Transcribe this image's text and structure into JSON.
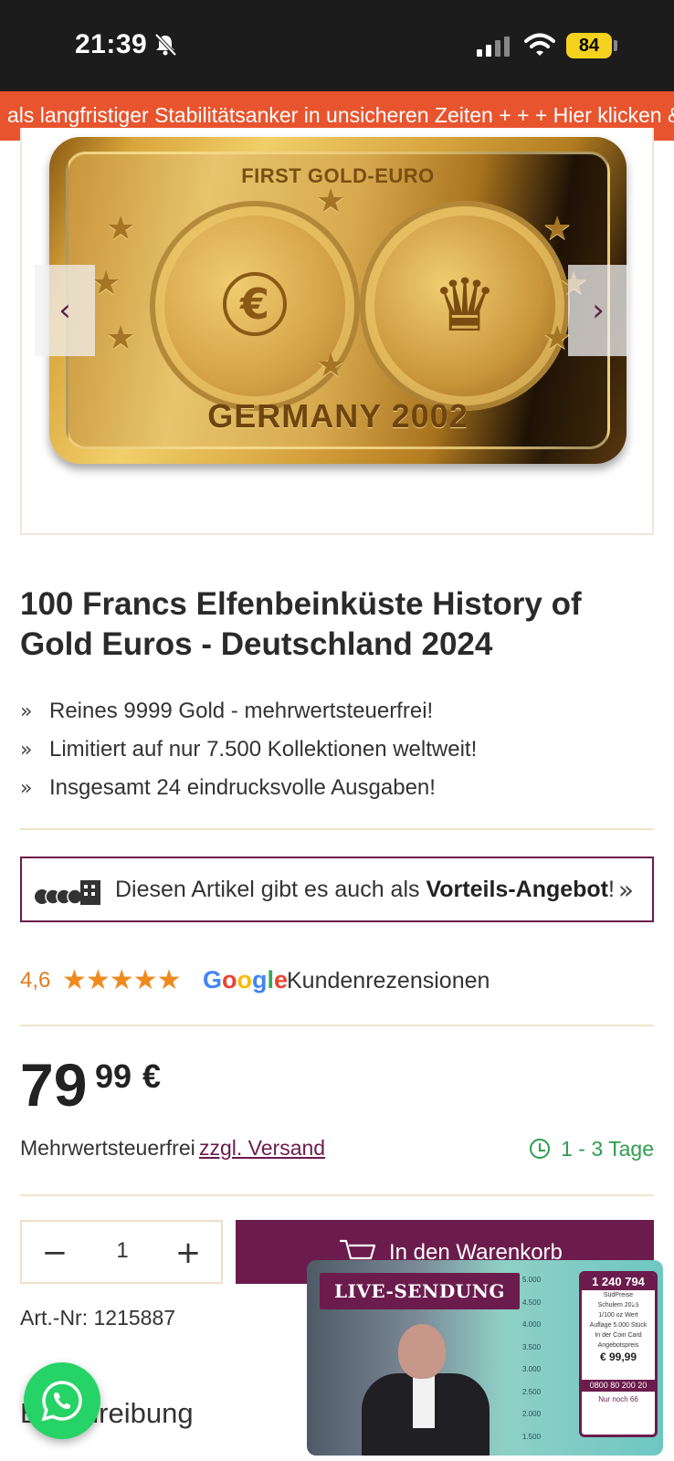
{
  "status_bar": {
    "time": "21:39",
    "battery": "84",
    "icons": [
      "bell-muted-icon",
      "signal-icon",
      "wifi-icon",
      "battery-icon"
    ]
  },
  "ticker": {
    "text": "als langfristiger Stabilitätsanker in unsicheren Zeiten + + + Hier klicken &",
    "color": "#e8542e"
  },
  "gallery": {
    "image_caption_top": "FIRST GOLD-EURO",
    "image_caption_bottom": "GERMANY 2002",
    "prev_label": "‹",
    "next_label": "›"
  },
  "product": {
    "title": "100 Francs Elfenbeinküste History of Gold Euros - Deutschland 2024",
    "bullets": [
      "Reines 9999 Gold - mehrwertsteuerfrei!",
      "Limitiert auf nur 7.500 Kollektionen weltweit!",
      "Insgesamt 24 eindrucksvolle Ausgaben!"
    ],
    "bullet_marker": "»"
  },
  "offer": {
    "text_prefix": "Diesen Artikel gibt es auch als ",
    "text_bold": "Vorteils-Angebot",
    "text_suffix": "!",
    "chevron": "»"
  },
  "rating": {
    "value": "4,6",
    "stars": "★★★★★",
    "stars_count": 5,
    "provider": "Google",
    "label": "Kundenrezensionen"
  },
  "price": {
    "whole": "79",
    "cents": "99",
    "currency": "€"
  },
  "shipping": {
    "vat": "Mehrwertsteuerfrei",
    "link": "zzgl. Versand",
    "delivery": "1 - 3 Tage"
  },
  "cart": {
    "quantity": "1",
    "minus": "−",
    "plus": "+",
    "button_label": "In den Warenkorb"
  },
  "article": {
    "number": "Art.-Nr: 1215887"
  },
  "description": {
    "heading": "Beschreibung"
  },
  "live": {
    "badge": "LIVE-SENDUNG",
    "card_number": "1 240 794",
    "card_lines": [
      "SüdPreise",
      "Schulem 2025",
      "1/100 oz Wert",
      "Auflage 5.000 Stück",
      "In der Coin Card",
      "Angebotspreis"
    ],
    "card_price": "€ 99,99",
    "card_phone": "0800 80 200 20",
    "card_remaining": "Nur noch 66",
    "chart_ticks": [
      "5.000",
      "4.500",
      "4.000",
      "3.500",
      "3.000",
      "2.500",
      "2.000",
      "1.500"
    ]
  },
  "colors": {
    "brand": "#6b1c4d",
    "accent": "#e8542e",
    "rating": "#f08a1e",
    "delivery": "#2d9e50",
    "whatsapp": "#25d366"
  }
}
